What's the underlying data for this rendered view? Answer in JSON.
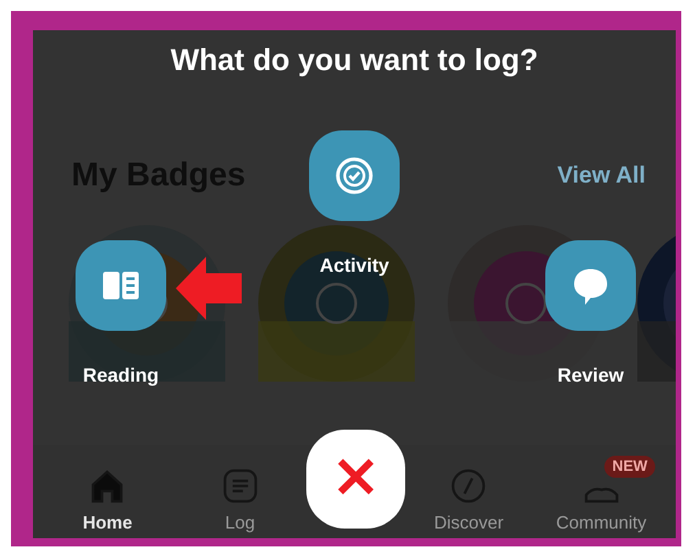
{
  "section": {
    "title": "My Badges",
    "link": "View All"
  },
  "nav": [
    {
      "label": "Home",
      "selected": true
    },
    {
      "label": "Log",
      "selected": false
    },
    {
      "label": "Discover",
      "selected": false
    },
    {
      "label": "Community",
      "selected": false,
      "badge": "NEW"
    }
  ],
  "dialog": {
    "title": "What do you want to log?",
    "options": [
      {
        "kind": "activity",
        "label": "Activity"
      },
      {
        "kind": "reading",
        "label": "Reading",
        "pointed": true
      },
      {
        "kind": "review",
        "label": "Review"
      }
    ],
    "close": "×"
  }
}
